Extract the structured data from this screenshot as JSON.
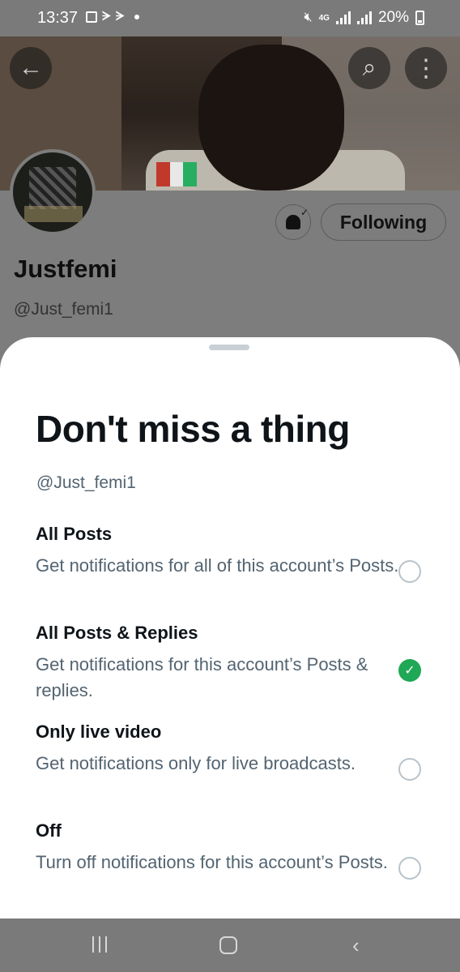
{
  "status_bar": {
    "time": "13:37",
    "network_label": "4G",
    "battery": "20%",
    "icons": [
      "gallery-icon",
      "media-icon",
      "media-icon",
      "dot-icon",
      "mute-icon",
      "signal-icon",
      "signal-icon",
      "battery-charging-icon"
    ]
  },
  "header": {
    "back_icon": "←",
    "search_icon": "⌕",
    "more_icon": "⋮"
  },
  "profile": {
    "name": "Justfemi",
    "handle": "@Just_femi1",
    "following_label": "Following"
  },
  "sheet": {
    "title": "Don't miss a thing",
    "handle": "@Just_femi1",
    "options": [
      {
        "title": "All Posts",
        "desc": "Get notifications for all of this account’s Posts.",
        "selected": false
      },
      {
        "title": "All Posts & Replies",
        "desc": "Get notifications for this account’s Posts & replies.",
        "selected": true
      },
      {
        "title": "Only live video",
        "desc": "Get notifications only for live broadcasts.",
        "selected": false
      },
      {
        "title": "Off",
        "desc": "Turn off notifications for this account’s Posts.",
        "selected": false
      }
    ]
  },
  "nav_bar": {
    "back_icon": "‹"
  },
  "colors": {
    "accent_green": "#1fa855",
    "text_primary": "#0f1419",
    "text_secondary": "#536471"
  }
}
